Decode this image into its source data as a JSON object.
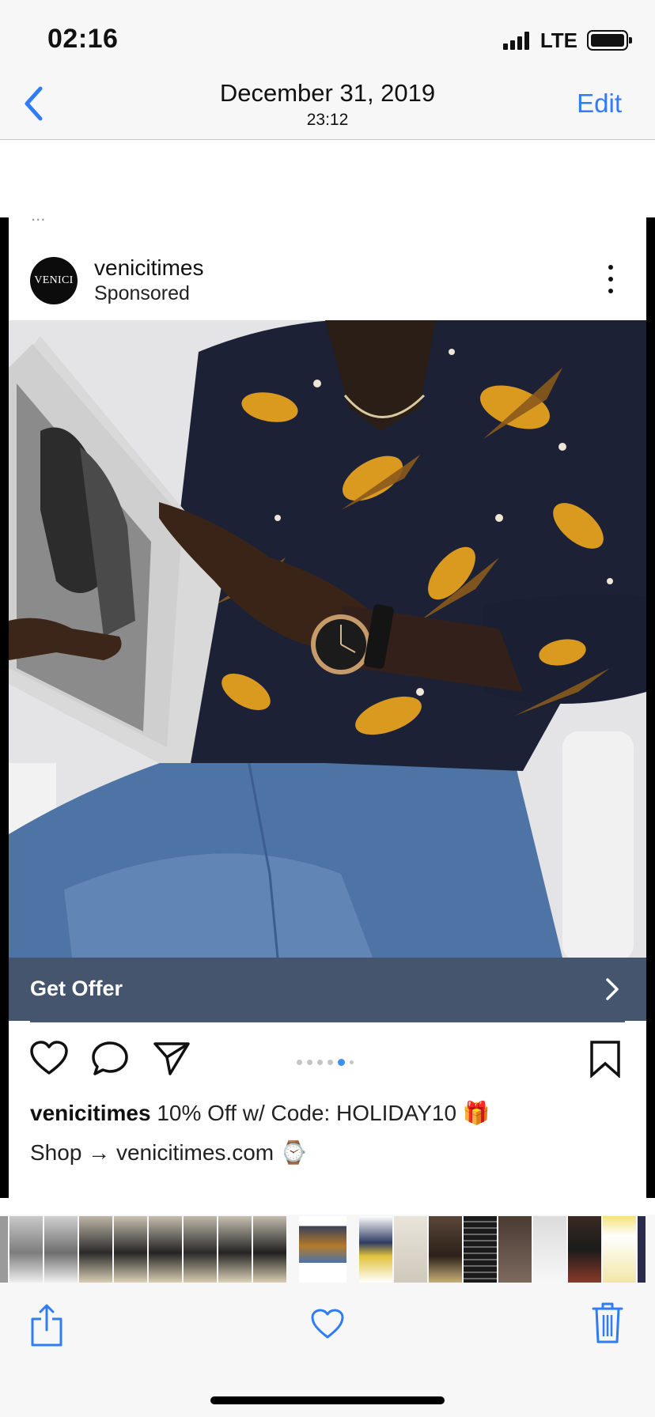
{
  "status_bar": {
    "time": "02:16",
    "network": "LTE"
  },
  "nav": {
    "title": "December 31, 2019",
    "subtitle": "23:12",
    "edit_label": "Edit"
  },
  "post": {
    "cut_text": "...",
    "avatar_text": "VENICI",
    "username": "venicitimes",
    "sponsored_label": "Sponsored",
    "cta_label": "Get Offer",
    "carousel": {
      "total": 6,
      "active_index": 4
    },
    "caption_user": "venicitimes",
    "caption_line1": "10% Off w/ Code: HOLIDAY10 🎁",
    "caption_line2": "Shop → venicitimes.com ⌚"
  },
  "colors": {
    "ios_blue": "#2f7cf6",
    "cta_bar": "#45556e",
    "carousel_active_dot": "#3f8ef5",
    "bar_background": "#f7f7f7"
  },
  "icons": {
    "back": "chevron-left-icon",
    "more": "more-vertical-icon",
    "like": "heart-outline-icon",
    "comment": "comment-bubble-icon",
    "share": "paper-plane-icon",
    "save": "bookmark-icon",
    "cta": "chevron-right-icon",
    "toolbar_share": "share-icon",
    "toolbar_favorite": "heart-icon",
    "toolbar_delete": "trash-icon"
  }
}
